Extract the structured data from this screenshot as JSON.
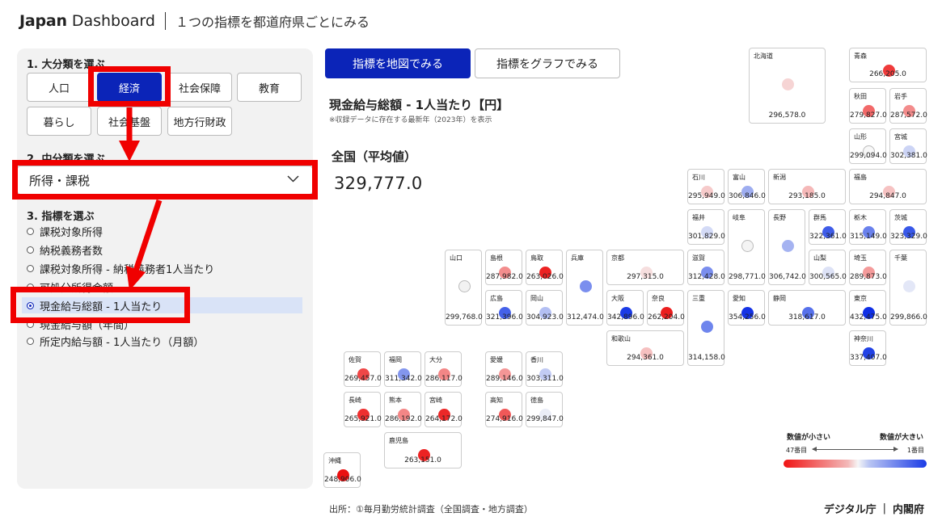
{
  "header": {
    "brand_bold": "Japan",
    "brand_rest": "Dashboard",
    "subtitle": "１つの指標を都道府県ごとにみる"
  },
  "sidebar": {
    "section1_label": "1. 大分類を選ぶ",
    "categories": [
      {
        "label": "人口",
        "active": false
      },
      {
        "label": "経済",
        "active": true
      },
      {
        "label": "社会保障",
        "active": false
      },
      {
        "label": "教育",
        "active": false
      },
      {
        "label": "暮らし",
        "active": false
      },
      {
        "label": "社会基盤",
        "active": false
      },
      {
        "label": "地方行財政",
        "active": false
      }
    ],
    "section2_label": "2. 中分類を選ぶ",
    "subcategory_selected": "所得・課税",
    "section3_label": "3. 指標を選ぶ",
    "indicators": [
      {
        "label": "課税対象所得",
        "selected": false
      },
      {
        "label": "納税義務者数",
        "selected": false
      },
      {
        "label": "課税対象所得 - 納税義務者1人当たり",
        "selected": false
      },
      {
        "label": "可処分所得金額",
        "selected": false
      },
      {
        "label": "現金給与総額 - 1人当たり",
        "selected": true
      },
      {
        "label": "現金給与額（年間）",
        "selected": false
      },
      {
        "label": "所定内給与額 - 1人当たり（月額）",
        "selected": false
      }
    ]
  },
  "tabs": {
    "map": "指標を地図でみる",
    "graph": "指標をグラフでみる"
  },
  "indicator": {
    "title": "現金給与総額 - 1人当たり【円】",
    "note": "※収録データに存在する最新年（2023年）を表示",
    "national_label": "全国（平均値）",
    "national_value": "329,777.0"
  },
  "prefectures": [
    {
      "name": "北海道",
      "value": "296,578.0",
      "color": "#f6d4d4"
    },
    {
      "name": "青森",
      "value": "266,205.0",
      "color": "#ef3b3b"
    },
    {
      "name": "秋田",
      "value": "279,827.0",
      "color": "#f26969"
    },
    {
      "name": "岩手",
      "value": "287,572.0",
      "color": "#f38c8c"
    },
    {
      "name": "山形",
      "value": "299,094.0",
      "color": "#f8f8f8"
    },
    {
      "name": "宮城",
      "value": "302,381.0",
      "color": "#ccd4f5"
    },
    {
      "name": "石川",
      "value": "295,949.0",
      "color": "#f6caca"
    },
    {
      "name": "富山",
      "value": "306,846.0",
      "color": "#9eadf0"
    },
    {
      "name": "新潟",
      "value": "293,185.0",
      "color": "#f5b8b8"
    },
    {
      "name": "福島",
      "value": "294,847.0",
      "color": "#f6c2c2"
    },
    {
      "name": "福井",
      "value": "301,829.0",
      "color": "#d3daf6"
    },
    {
      "name": "岐阜",
      "value": "298,771.0",
      "color": "#f4f4f4"
    },
    {
      "name": "長野",
      "value": "306,742.0",
      "color": "#a5b3f1"
    },
    {
      "name": "群馬",
      "value": "322,361.0",
      "color": "#3f5ce8"
    },
    {
      "name": "栃木",
      "value": "315,149.0",
      "color": "#6a81ec"
    },
    {
      "name": "茨城",
      "value": "323,329.0",
      "color": "#3858e8"
    },
    {
      "name": "山口",
      "value": "299,768.0",
      "color": "#f2f2f2"
    },
    {
      "name": "島根",
      "value": "287,982.0",
      "color": "#f38d8d"
    },
    {
      "name": "鳥取",
      "value": "263,026.0",
      "color": "#ec2222"
    },
    {
      "name": "兵庫",
      "value": "312,474.0",
      "color": "#7a8eee"
    },
    {
      "name": "京都",
      "value": "297,315.0",
      "color": "#f6dede"
    },
    {
      "name": "滋賀",
      "value": "312,428.0",
      "color": "#7a8eee"
    },
    {
      "name": "山梨",
      "value": "300,565.0",
      "color": "#dde2f6"
    },
    {
      "name": "埼玉",
      "value": "289,873.0",
      "color": "#f49b9b"
    },
    {
      "name": "千葉",
      "value": "299,866.0",
      "color": "#e3e7f7"
    },
    {
      "name": "広島",
      "value": "321,396.0",
      "color": "#4461e9"
    },
    {
      "name": "岡山",
      "value": "304,923.0",
      "color": "#b3bff3"
    },
    {
      "name": "大阪",
      "value": "342,896.0",
      "color": "#1b3be6"
    },
    {
      "name": "奈良",
      "value": "262,204.0",
      "color": "#eb1e1e"
    },
    {
      "name": "三重",
      "value": "314,158.0",
      "color": "#6e85ed"
    },
    {
      "name": "愛知",
      "value": "354,256.0",
      "color": "#1533e5"
    },
    {
      "name": "静岡",
      "value": "318,617.0",
      "color": "#5771eb"
    },
    {
      "name": "東京",
      "value": "432,475.0",
      "color": "#0f2fe5"
    },
    {
      "name": "和歌山",
      "value": "294,361.0",
      "color": "#f6c0c0"
    },
    {
      "name": "神奈川",
      "value": "337,407.0",
      "color": "#2242e6"
    },
    {
      "name": "佐賀",
      "value": "269,457.0",
      "color": "#ef4747"
    },
    {
      "name": "福岡",
      "value": "311,342.0",
      "color": "#8396ee"
    },
    {
      "name": "大分",
      "value": "286,117.0",
      "color": "#f38686"
    },
    {
      "name": "愛媛",
      "value": "289,146.0",
      "color": "#f49696"
    },
    {
      "name": "香川",
      "value": "303,311.0",
      "color": "#c2cbf4"
    },
    {
      "name": "長崎",
      "value": "265,921.0",
      "color": "#ee3030"
    },
    {
      "name": "熊本",
      "value": "286,192.0",
      "color": "#f38686"
    },
    {
      "name": "宮崎",
      "value": "264,172.0",
      "color": "#ec2828"
    },
    {
      "name": "高知",
      "value": "274,916.0",
      "color": "#f05858"
    },
    {
      "name": "徳島",
      "value": "299,847.0",
      "color": "#eaedf7"
    },
    {
      "name": "鹿児島",
      "value": "263,151.0",
      "color": "#ec2323"
    },
    {
      "name": "沖縄",
      "value": "248,906.0",
      "color": "#ea1010"
    }
  ],
  "legend": {
    "small": "数値が小さい",
    "large": "数値が大きい",
    "rank_low": "47番目",
    "rank_high": "1番目"
  },
  "footer": {
    "source": "出所：①毎月勤労統計調査（全国調査・地方調査）",
    "org1": "デジタル庁",
    "sep": "|",
    "org2": "内閣府"
  }
}
